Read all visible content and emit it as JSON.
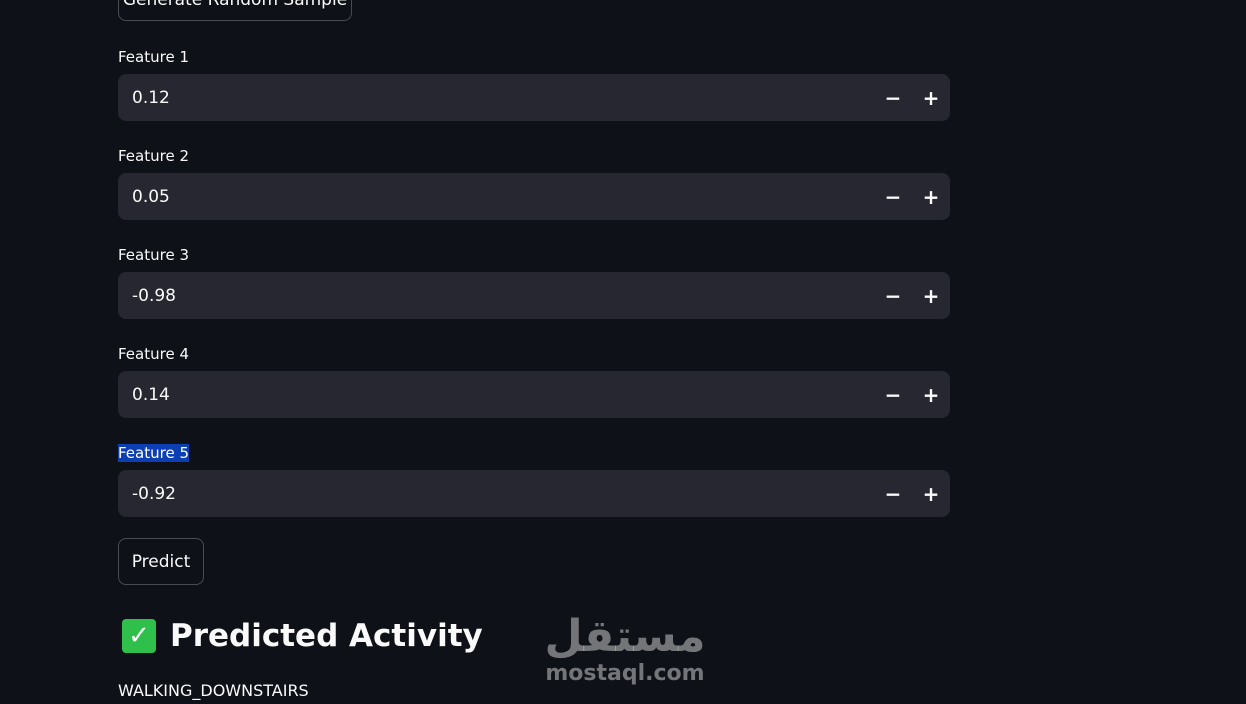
{
  "top_button": {
    "label": "Generate Random Sample"
  },
  "fields": [
    {
      "label": "Feature 1",
      "value": "0.12",
      "minus": "−",
      "plus": "+"
    },
    {
      "label": "Feature 2",
      "value": "0.05",
      "minus": "−",
      "plus": "+"
    },
    {
      "label": "Feature 3",
      "value": "-0.98",
      "minus": "−",
      "plus": "+"
    },
    {
      "label": "Feature 4",
      "value": "0.14",
      "minus": "−",
      "plus": "+"
    },
    {
      "label": "Feature 5",
      "value": "-0.92",
      "minus": "−",
      "plus": "+"
    }
  ],
  "predict_button": {
    "label": "Predict"
  },
  "result": {
    "icon": "check-mark-icon",
    "icon_glyph": "✓",
    "heading": "Predicted Activity",
    "value": "WALKING_DOWNSTAIRS"
  },
  "watermark": {
    "arabic": "مستقل",
    "latin": "mostaql.com"
  },
  "colors": {
    "background": "#0e1117",
    "input_bg": "#262730",
    "selection": "#0b3fb3",
    "check": "#2ec04a"
  }
}
